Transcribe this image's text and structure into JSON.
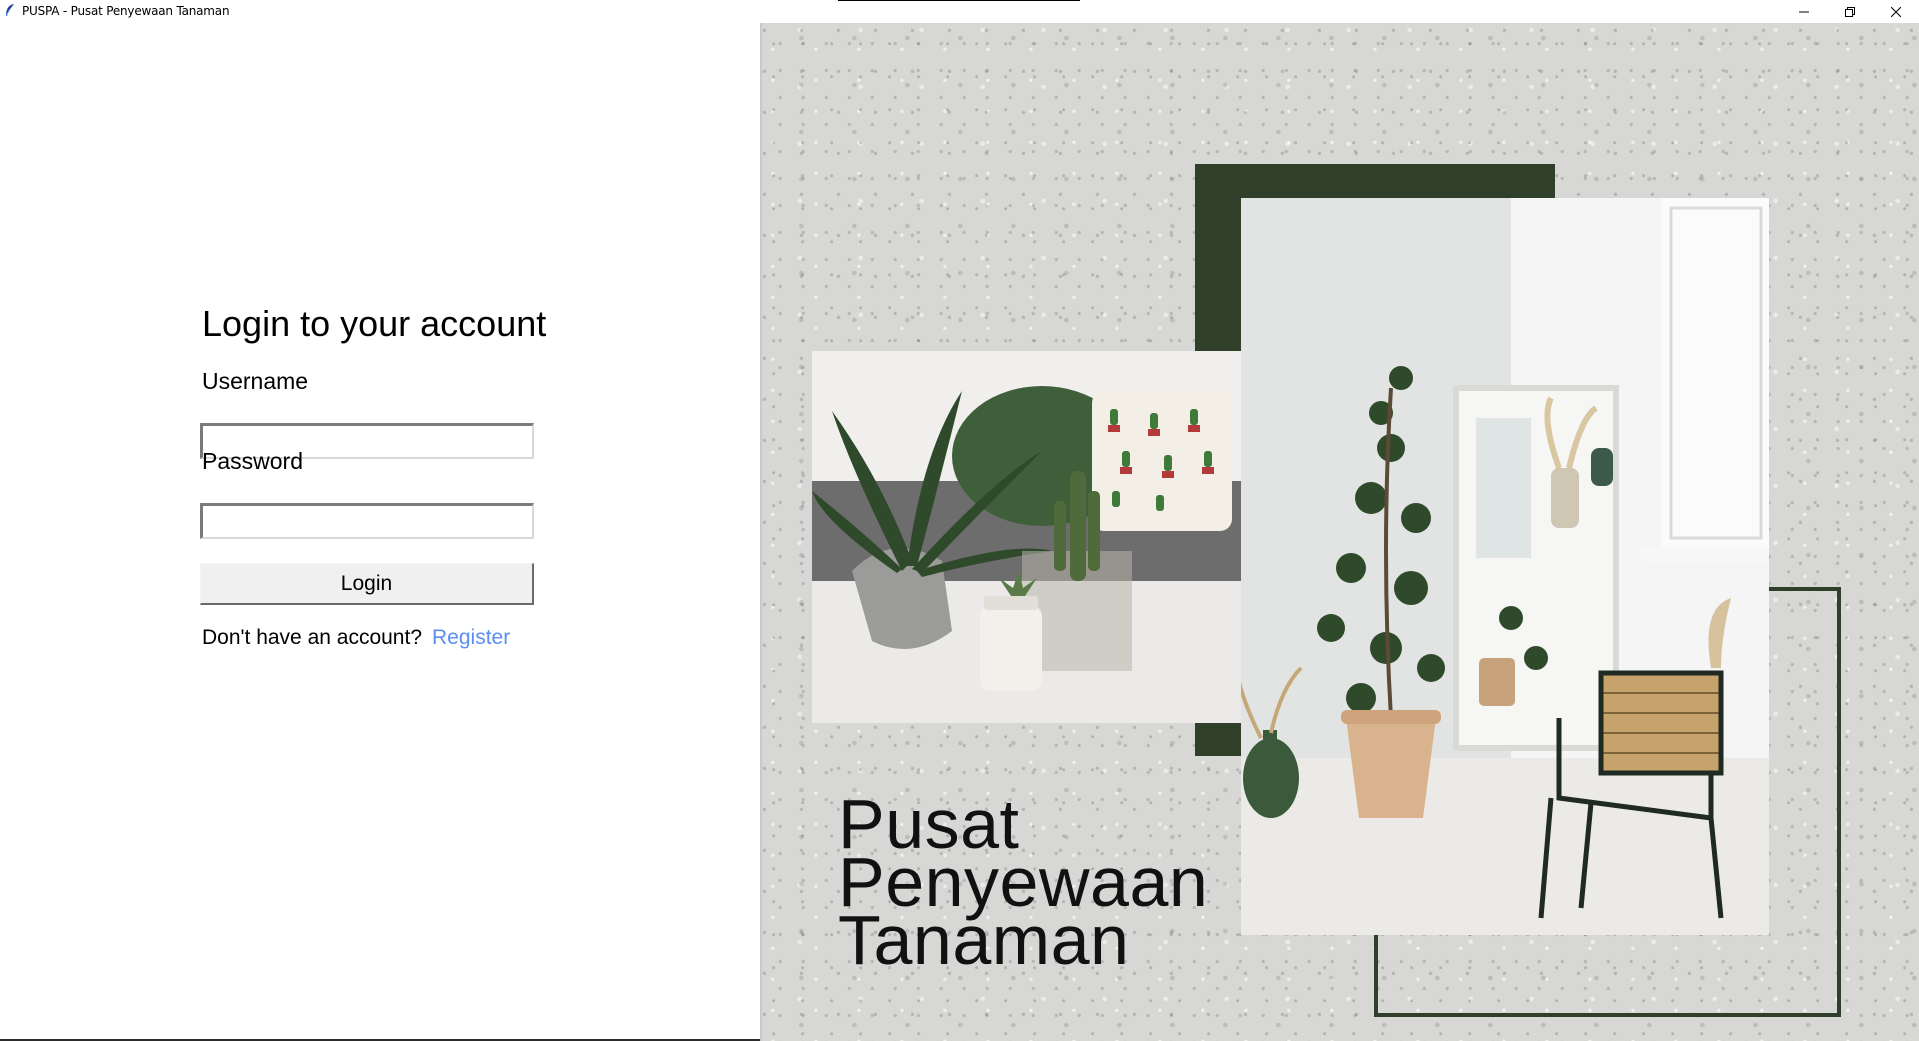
{
  "window": {
    "title": "PUSPA - Pusat Penyewaan Tanaman",
    "buttons": [
      "minimize",
      "restore",
      "close"
    ]
  },
  "login": {
    "heading": "Login to your account",
    "username_label": "Username",
    "username_value": "",
    "password_label": "Password",
    "password_value": "",
    "login_button": "Login",
    "signup_prompt": "Don't have an account?",
    "register_link": "Register"
  },
  "brand": {
    "line1": "Pusat",
    "line2": "Penyewaan",
    "line3": "Tanaman"
  },
  "colors": {
    "accent_green": "#2f3f29",
    "link_blue": "#5a8ef0",
    "concrete": "#d7d7d5"
  },
  "icons": [
    "feather-icon",
    "minimize-icon",
    "restore-icon",
    "close-icon"
  ]
}
